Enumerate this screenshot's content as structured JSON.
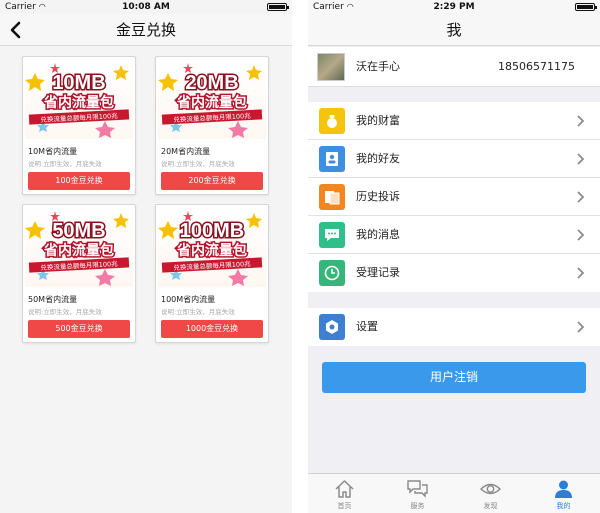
{
  "left_screen": {
    "status": {
      "carrier": "Carrier",
      "time": "10:08 AM"
    },
    "nav_title": "金豆兑换",
    "products": [
      {
        "banner_size": "10MB",
        "banner_title": "省内流量包",
        "banner_note": "兑换流量总额每月限100兆",
        "name": "10M省内流量",
        "desc": "说明:立即生效，月底失效",
        "button": "100金豆兑换"
      },
      {
        "banner_size": "20MB",
        "banner_title": "省内流量包",
        "banner_note": "兑换流量总额每月限100兆",
        "name": "20M省内流量",
        "desc": "说明:立即生效，月底失效",
        "button": "200金豆兑换"
      },
      {
        "banner_size": "50MB",
        "banner_title": "省内流量包",
        "banner_note": "兑换流量总额每月限100兆",
        "name": "50M省内流量",
        "desc": "说明:立即生效，月底失效",
        "button": "500金豆兑换"
      },
      {
        "banner_size": "100MB",
        "banner_title": "省内流量包",
        "banner_note": "兑换流量总额每月限100兆",
        "name": "100M省内流量",
        "desc": "说明:立即生效，月底失效",
        "button": "1000金豆兑换"
      }
    ]
  },
  "right_screen": {
    "status": {
      "carrier": "Carrier",
      "time": "2:29 PM"
    },
    "nav_title": "我",
    "profile": {
      "name": "沃在手心",
      "phone": "18506571175"
    },
    "menu": [
      {
        "label": "我的财富",
        "icon": "money-bag-icon",
        "color": "#f5c40c"
      },
      {
        "label": "我的好友",
        "icon": "contacts-icon",
        "color": "#3d8fe0"
      },
      {
        "label": "历史投诉",
        "icon": "documents-icon",
        "color": "#f4861f"
      },
      {
        "label": "我的消息",
        "icon": "message-icon",
        "color": "#2fbf8a"
      },
      {
        "label": "受理记录",
        "icon": "clock-icon",
        "color": "#35b67a"
      }
    ],
    "settings": {
      "label": "设置",
      "icon": "gear-icon",
      "color": "#3d7fd0"
    },
    "logout_button": "用户注销",
    "tabs": [
      {
        "label": "首页",
        "icon": "home-icon"
      },
      {
        "label": "服务",
        "icon": "chat-bubbles-icon"
      },
      {
        "label": "发现",
        "icon": "eye-icon"
      },
      {
        "label": "我的",
        "icon": "person-icon",
        "active": true
      }
    ]
  }
}
